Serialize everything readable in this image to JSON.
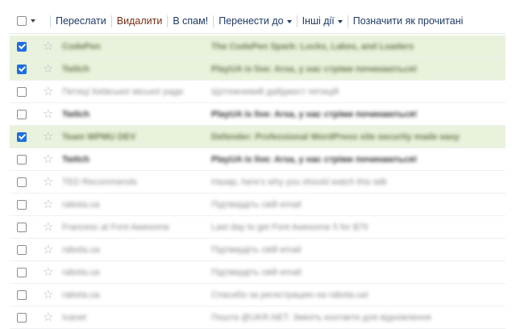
{
  "toolbar": {
    "forward": "Переслати",
    "delete": "Видалити",
    "spam": "В спам!",
    "move_to": "Перенести до",
    "other_actions": "Інші дії",
    "mark_read": "Позначити як прочитані"
  },
  "colors": {
    "selected_row": "#e9f2dc",
    "checkbox_checked": "#1e6fe0",
    "toolbar_text": "#1f3a66",
    "delete_text": "#7a2c14"
  },
  "rows": [
    {
      "from": "CodePen",
      "subject": "The CodePen Spark: Locks, Lakes, and Loaders",
      "checked": true,
      "unread": true
    },
    {
      "from": "Twitch",
      "subject": "PlayUA is live: Arsa, у нас стріми починаються!",
      "checked": true,
      "unread": true
    },
    {
      "from": "Петицї Київської міської ради",
      "subject": "Щотижневий дайджест петицій",
      "checked": false,
      "unread": false
    },
    {
      "from": "Twitch",
      "subject": "PlayUA is live: Arsa, у нас стріми починаються!",
      "checked": false,
      "unread": true
    },
    {
      "from": "Team WPMU DEV",
      "subject": "Defender: Professional WordPress site security made easy",
      "checked": true,
      "unread": true
    },
    {
      "from": "Twitch",
      "subject": "PlayUA is live: Arsa, у нас стріми починаються!",
      "checked": false,
      "unread": true
    },
    {
      "from": "TED Recommends",
      "subject": "Назар, here's why you should watch this talk",
      "checked": false,
      "unread": false
    },
    {
      "from": "rabota.ua",
      "subject": "Підтвердіть свій email",
      "checked": false,
      "unread": false
    },
    {
      "from": "Francesc at Font Awesome",
      "subject": "Last day to get Font Awesome 5 for $79",
      "checked": false,
      "unread": false
    },
    {
      "from": "rabota.ua",
      "subject": "Підтвердіть свій email",
      "checked": false,
      "unread": false
    },
    {
      "from": "rabota.ua",
      "subject": "Підтвердіть свій email",
      "checked": false,
      "unread": false
    },
    {
      "from": "rabota.ua",
      "subject": "Спасибо за регистрацию на rabota.ua!",
      "checked": false,
      "unread": false
    },
    {
      "from": "Ivanet",
      "subject": "Пошта @UKR.NET. Змініть контакти для відновлення",
      "checked": false,
      "unread": false
    }
  ]
}
